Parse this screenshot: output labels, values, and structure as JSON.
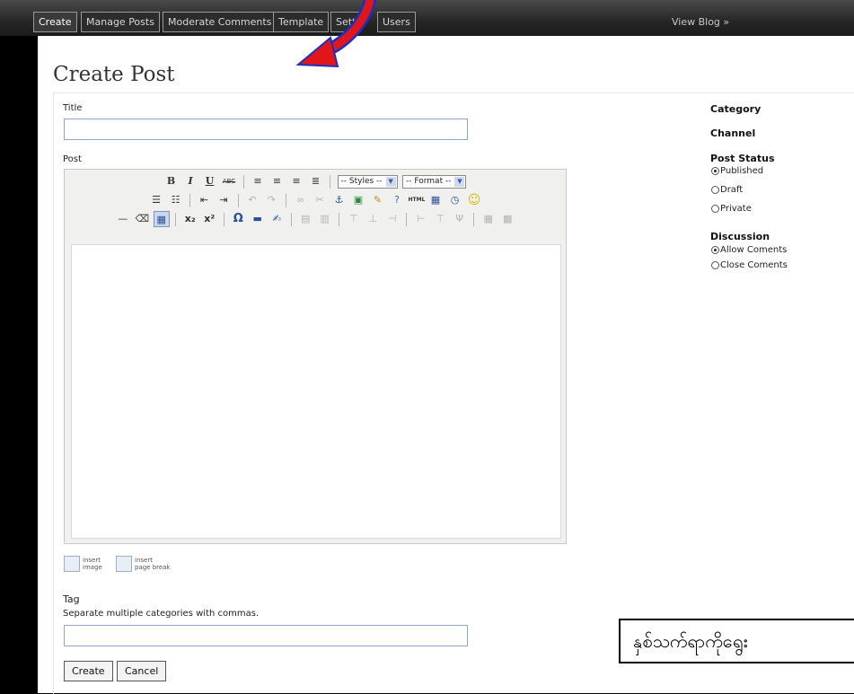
{
  "nav": {
    "tabs": [
      {
        "label": "Create",
        "active": true
      },
      {
        "label": "Manage Posts",
        "active": false
      },
      {
        "label": "Moderate Comments",
        "active": false
      },
      {
        "label": "Template",
        "active": false
      },
      {
        "label": "Sett",
        "active": false
      },
      {
        "label": "Users",
        "active": false
      }
    ],
    "view_blog": "View Blog »"
  },
  "page": {
    "title": "Create Post"
  },
  "form": {
    "title_label": "Title",
    "title_value": "",
    "post_label": "Post",
    "toolbar": {
      "styles_select": "-- Styles --",
      "format_select": "-- Format --"
    },
    "media": {
      "insert_image": [
        "insert",
        "image"
      ],
      "insert_page_break": [
        "insert",
        "page break"
      ]
    },
    "tag_label": "Tag",
    "tag_hint": "Separate multiple categories with commas.",
    "tag_value": "",
    "create_button": "Create",
    "cancel_button": "Cancel"
  },
  "sidebar": {
    "category": "Category",
    "channel": "Channel",
    "post_status": {
      "heading": "Post Status",
      "options": [
        "Published",
        "Draft",
        "Private"
      ],
      "selected": "Published"
    },
    "discussion": {
      "heading": "Discussion",
      "options": [
        "Allow Coments",
        "Close Coments"
      ],
      "selected": "Allow Coments"
    }
  },
  "annotation": {
    "text": "နှစ်သက်ရာကိုရွေး",
    "arrow_colors": {
      "fill": "#e0161b",
      "outline": "#1a2fc4"
    }
  }
}
